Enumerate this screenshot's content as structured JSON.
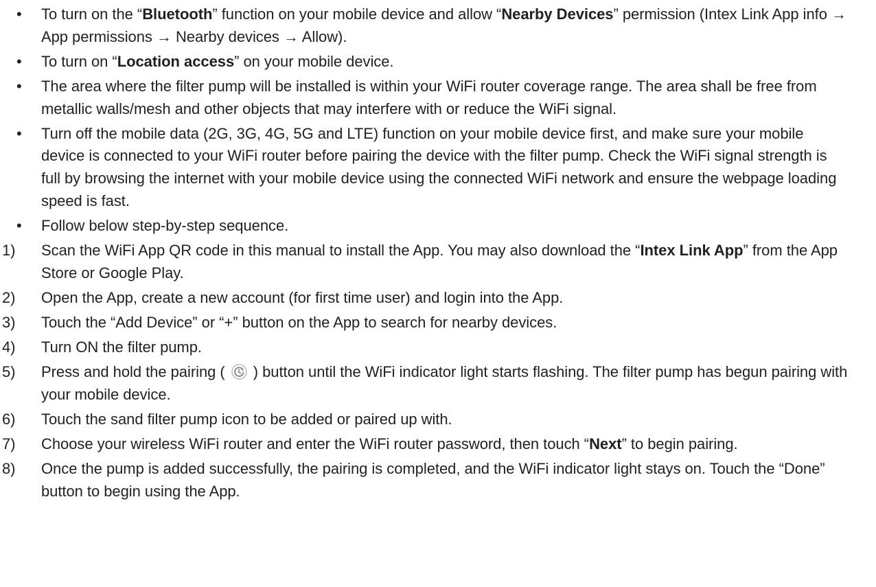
{
  "bullets": [
    {
      "marker": "•",
      "segments": [
        {
          "text": "To turn on the “",
          "bold": false
        },
        {
          "text": "Bluetooth",
          "bold": true
        },
        {
          "text": "” function on your mobile device and allow “",
          "bold": false
        },
        {
          "text": "Nearby Devices",
          "bold": true
        },
        {
          "text": "” permission (Intex Link App info → App permissions → Nearby devices → Allow).",
          "bold": false
        }
      ]
    },
    {
      "marker": "•",
      "segments": [
        {
          "text": "To turn on “",
          "bold": false
        },
        {
          "text": "Location access",
          "bold": true
        },
        {
          "text": "” on your mobile device.",
          "bold": false
        }
      ]
    },
    {
      "marker": "•",
      "segments": [
        {
          "text": "The area where the filter pump will be installed is within your WiFi router coverage range. The area shall be free from metallic walls/mesh and other objects that may interfere with or reduce the WiFi signal.",
          "bold": false
        }
      ]
    },
    {
      "marker": "•",
      "segments": [
        {
          "text": "Turn off the mobile data (2G, 3G, 4G, 5G and LTE) function on your mobile device first, and make sure your mobile device is connected to your WiFi router before pairing the device with the filter pump. Check the WiFi signal strength is full by browsing the internet with your mobile device using the connected WiFi network and ensure the webpage loading speed is fast.",
          "bold": false
        }
      ]
    },
    {
      "marker": "•",
      "segments": [
        {
          "text": "Follow below step-by-step sequence.",
          "bold": false
        }
      ]
    }
  ],
  "steps": [
    {
      "marker": "1)",
      "segments": [
        {
          "text": "Scan the WiFi App QR code in this manual to install the App. You may also download the “",
          "bold": false
        },
        {
          "text": "Intex Link App",
          "bold": true
        },
        {
          "text": "” from the App Store or Google Play.",
          "bold": false
        }
      ]
    },
    {
      "marker": "2)",
      "segments": [
        {
          "text": "Open the App, create a new account (for first time user) and login into the App.",
          "bold": false
        }
      ]
    },
    {
      "marker": "3)",
      "segments": [
        {
          "text": "Touch the “Add Device” or “+” button on the App to search for nearby devices.",
          "bold": false
        }
      ]
    },
    {
      "marker": "4)",
      "segments": [
        {
          "text": "Turn ON the filter pump.",
          "bold": false
        }
      ]
    },
    {
      "marker": "5)",
      "segments": [
        {
          "text": "Press and hold the pairing ( ",
          "bold": false
        },
        {
          "icon": "pairing-icon"
        },
        {
          "text": " ) button until the WiFi indicator light starts flashing. The filter pump has begun pairing with your mobile device.",
          "bold": false
        }
      ]
    },
    {
      "marker": "6)",
      "segments": [
        {
          "text": "Touch the sand filter pump icon to be added or paired up with.",
          "bold": false
        }
      ]
    },
    {
      "marker": "7)",
      "segments": [
        {
          "text": "Choose your wireless WiFi router and enter the WiFi router password, then touch “",
          "bold": false
        },
        {
          "text": "Next",
          "bold": true
        },
        {
          "text": "” to begin pairing.",
          "bold": false
        }
      ]
    },
    {
      "marker": "8)",
      "segments": [
        {
          "text": "Once the pump is added successfully, the pairing is completed, and the WiFi indicator light stays on. Touch the “Done” button to begin using the App.",
          "bold": false
        }
      ]
    }
  ],
  "colors": {
    "text": "#231f20",
    "icon": "#8a8a8a"
  }
}
